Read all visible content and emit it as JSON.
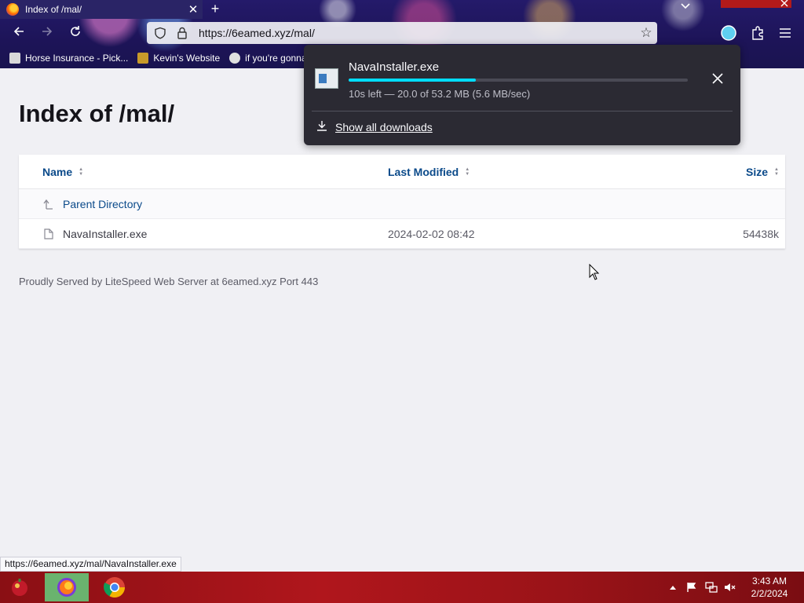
{
  "browser": {
    "tab_title": "Index of /mal/",
    "tab_close": "✕",
    "new_tab": "+",
    "url": "https://6eamed.xyz/mal/",
    "bookmarks": [
      {
        "label": "Horse Insurance - Pick..."
      },
      {
        "label": "Kevin's Website"
      },
      {
        "label": "if you're gonna"
      }
    ],
    "accent": "#00ddff"
  },
  "page": {
    "title": "Index of /mal/",
    "columns": {
      "name": "Name",
      "modified": "Last Modified",
      "size": "Size"
    },
    "rows": [
      {
        "name": "Parent Directory",
        "modified": "",
        "size": ""
      },
      {
        "name": "NavaInstaller.exe",
        "modified": "2024-02-02 08:42",
        "size": "54438k"
      }
    ],
    "footer": "Proudly Served by LiteSpeed Web Server at 6eamed.xyz Port 443"
  },
  "download": {
    "filename": "NavaInstaller.exe",
    "status": "10s left — 20.0 of 53.2 MB (5.6 MB/sec)",
    "progress": 0.376,
    "show_all": "Show all downloads"
  },
  "statusbar": {
    "url": "https://6eamed.xyz/mal/NavaInstaller.exe"
  },
  "taskbar": {
    "time": "3:43 AM",
    "date": "2/2/2024"
  }
}
